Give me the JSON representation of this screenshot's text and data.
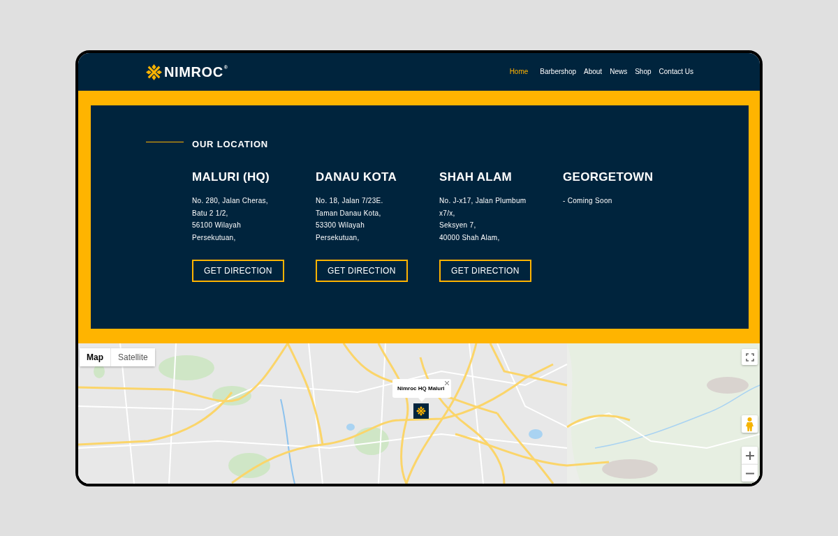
{
  "header": {
    "logo": "NIMROC$^{®}$",
    "nav": [
      {
        "label": "Home",
        "selected": true
      },
      {
        "label": "Barbershop",
        "selected": false
      },
      {
        "label": "About",
        "selected": false
      },
      {
        "label": "News",
        "selected": false
      },
      {
        "label": "Shop",
        "selected": false
      },
      {
        "label": "Contact Us",
        "selected": false
      }
    ]
  },
  "locations": {
    "title": "OUR LOCATION",
    "branches": [
      {
        "name": "MALURI (HQ)",
        "address": [
          "No. 280, Jalan Cheras,",
          "Batu 2 1/2,",
          "56100 Wilayah",
          "Persekutuan,"
        ],
        "button": "GET DIRECTION"
      },
      {
        "name": "DANAU KOTA",
        "address": [
          "No. 18, Jalan 7/23E.",
          "Taman Danau Kota,",
          "53300 Wilayah",
          "Persekutuan,"
        ],
        "button": "GET DIRECTION"
      },
      {
        "name": "SHAH ALAM",
        "address": [
          "No. J-x17, Jalan Plumbum",
          "x7/x,",
          "Seksyen 7,",
          "40000 Shah Alam,"
        ],
        "button": "GET DIRECTION"
      },
      {
        "name": "GEORGETOWN",
        "address": [
          "- Coming Soon"
        ]
      }
    ]
  },
  "map": {
    "types": [
      {
        "label": "Map",
        "selected": true
      },
      {
        "label": "Satellite",
        "selected": false
      }
    ],
    "info_window": {
      "title": "Nimroc HQ Maluri"
    }
  }
}
